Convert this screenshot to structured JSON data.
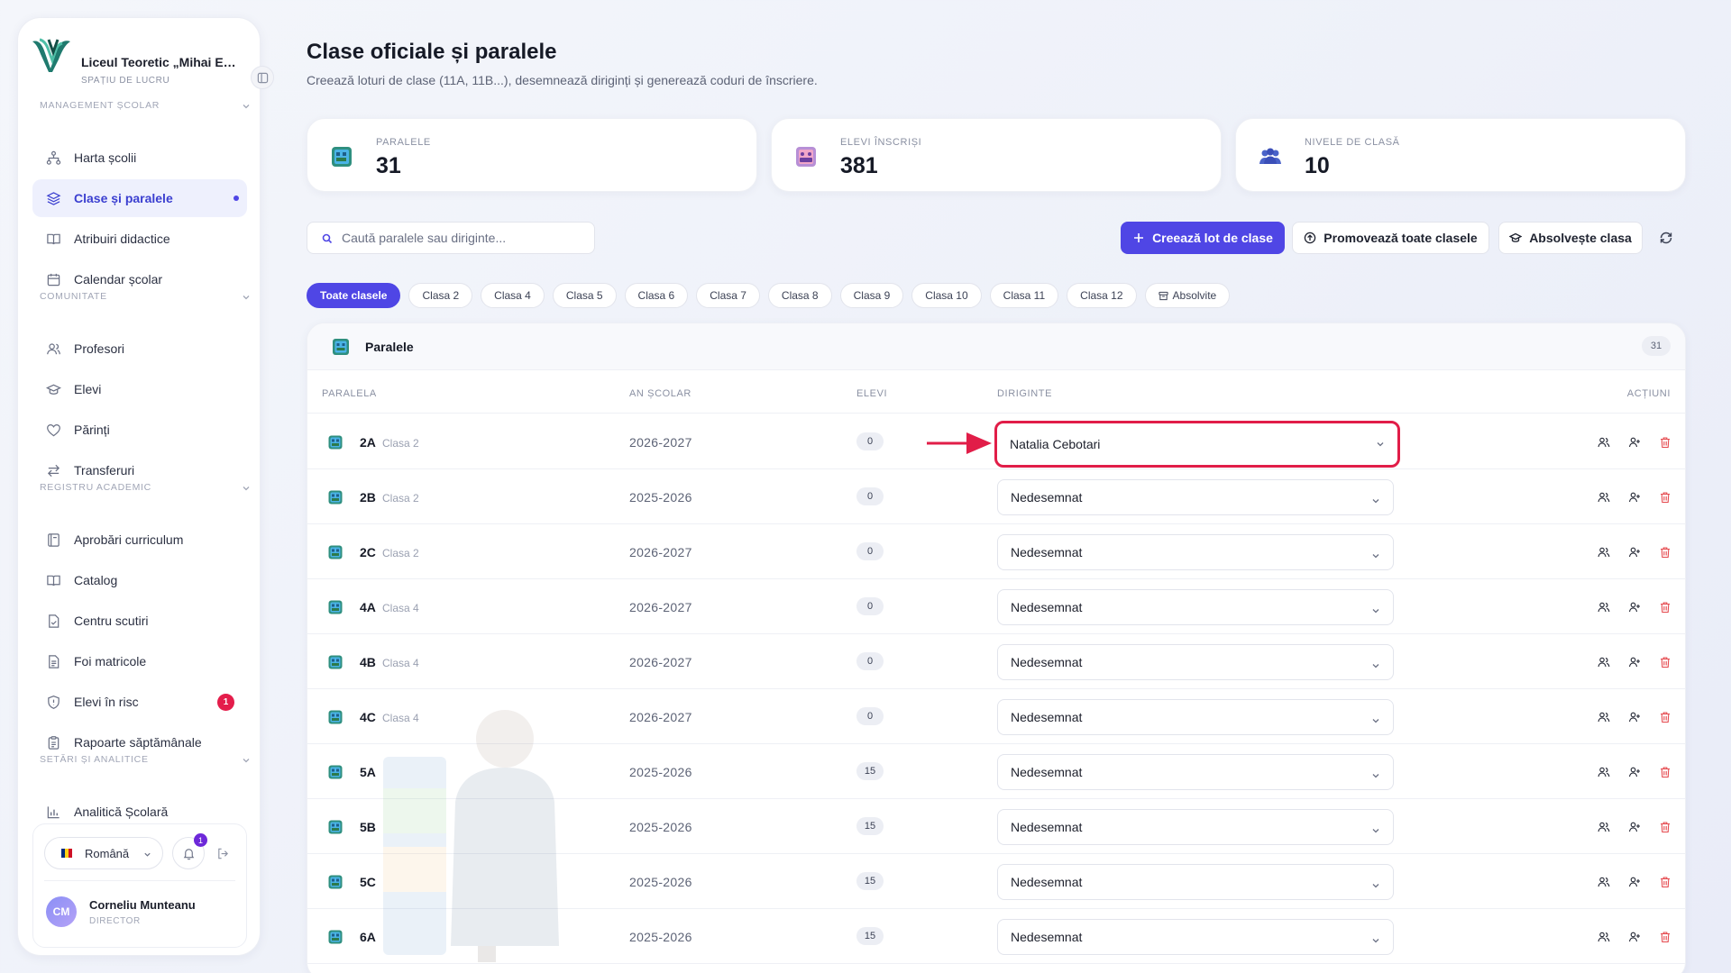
{
  "sidebar": {
    "school_name": "Liceul Teoretic „Mihai Eminescu”",
    "workspace_label": "SPAȚIU DE LUCRU",
    "sections": [
      {
        "title": "MANAGEMENT ȘCOLAR",
        "items": [
          "Harta școlii",
          "Clase și paralele",
          "Atribuiri didactice",
          "Calendar școlar"
        ]
      },
      {
        "title": "COMUNITATE",
        "items": [
          "Profesori",
          "Elevi",
          "Părinți",
          "Transferuri"
        ]
      },
      {
        "title": "REGISTRU ACADEMIC",
        "items": [
          "Aprobări curriculum",
          "Catalog",
          "Centru scutiri",
          "Foi matricole",
          "Elevi în risc",
          "Rapoarte săptămânale"
        ]
      },
      {
        "title": "SETĂRI ȘI ANALITICE",
        "items": [
          "Analitică Școlară"
        ]
      }
    ],
    "active_item": "Clase și paralele",
    "risk_badge": "1",
    "language": "Română",
    "notif_badge": "1",
    "user": {
      "initials": "CM",
      "name": "Corneliu Munteanu",
      "role": "DIRECTOR"
    }
  },
  "header": {
    "title": "Clase oficiale și paralele",
    "subtitle": "Creează loturi de clase (11A, 11B...), desemnează diriginți și generează coduri de înscriere."
  },
  "stats": [
    {
      "label": "PARALELE",
      "value": "31",
      "icon": "building-icon"
    },
    {
      "label": "ELEVI ÎNSCRIȘI",
      "value": "381",
      "icon": "students-icon"
    },
    {
      "label": "NIVELE DE CLASĂ",
      "value": "10",
      "icon": "people-icon"
    }
  ],
  "toolbar": {
    "search_placeholder": "Caută paralele sau diriginte...",
    "create_label": "Creează lot de clase",
    "promote_label": "Promovează toate clasele",
    "graduate_label": "Absolvește clasa"
  },
  "filters": [
    "Toate clasele",
    "Clasa 2",
    "Clasa 4",
    "Clasa 5",
    "Clasa 6",
    "Clasa 7",
    "Clasa 8",
    "Clasa 9",
    "Clasa 10",
    "Clasa 11",
    "Clasa 12",
    "Absolvite"
  ],
  "table": {
    "title": "Paralele",
    "count": "31",
    "columns": [
      "PARALELA",
      "AN ȘCOLAR",
      "ELEVI",
      "DIRIGINTE",
      "ACȚIUNI"
    ],
    "rows": [
      {
        "name": "2A",
        "level": "Clasa 2",
        "year": "2026-2027",
        "students": "0",
        "teacher": "Natalia Cebotari"
      },
      {
        "name": "2B",
        "level": "Clasa 2",
        "year": "2025-2026",
        "students": "0",
        "teacher": "Nedesemnat"
      },
      {
        "name": "2C",
        "level": "Clasa 2",
        "year": "2026-2027",
        "students": "0",
        "teacher": "Nedesemnat"
      },
      {
        "name": "4A",
        "level": "Clasa 4",
        "year": "2026-2027",
        "students": "0",
        "teacher": "Nedesemnat"
      },
      {
        "name": "4B",
        "level": "Clasa 4",
        "year": "2026-2027",
        "students": "0",
        "teacher": "Nedesemnat"
      },
      {
        "name": "4C",
        "level": "Clasa 4",
        "year": "2026-2027",
        "students": "0",
        "teacher": "Nedesemnat"
      },
      {
        "name": "5A",
        "level": "",
        "year": "2025-2026",
        "students": "15",
        "teacher": "Nedesemnat"
      },
      {
        "name": "5B",
        "level": "",
        "year": "2025-2026",
        "students": "15",
        "teacher": "Nedesemnat"
      },
      {
        "name": "5C",
        "level": "",
        "year": "2025-2026",
        "students": "15",
        "teacher": "Nedesemnat"
      },
      {
        "name": "6A",
        "level": "",
        "year": "2025-2026",
        "students": "15",
        "teacher": "Nedesemnat"
      }
    ]
  },
  "colors": {
    "accent": "#4f46e5",
    "highlight": "#e11d48",
    "danger": "#e5484d"
  }
}
